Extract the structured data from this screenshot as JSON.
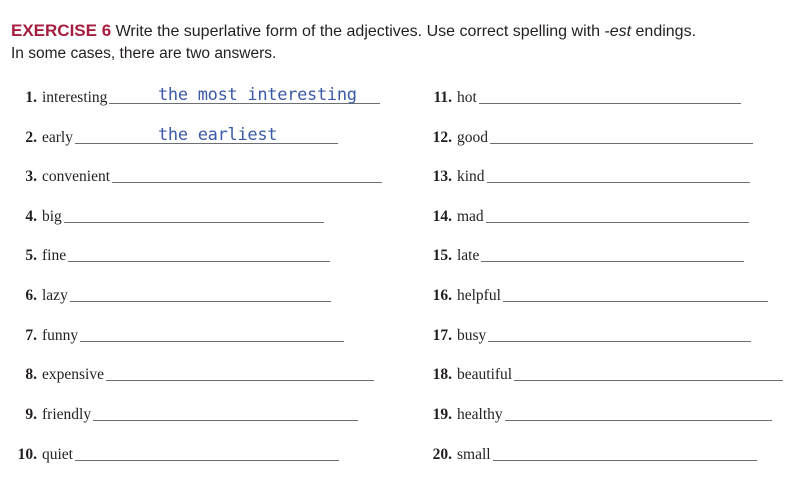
{
  "header": {
    "exercise_label": "EXERCISE 6",
    "instruction_a": "Write the superlative form of the adjectives. Use correct spelling with ",
    "instruction_em": "-est",
    "instruction_b": " endings.",
    "line2": "In some cases, there are two answers."
  },
  "items": [
    {
      "num": "1.",
      "word": "interesting",
      "answer": "the most interesting"
    },
    {
      "num": "2.",
      "word": "early",
      "answer": "the earliest"
    },
    {
      "num": "3.",
      "word": "convenient",
      "answer": ""
    },
    {
      "num": "4.",
      "word": "big",
      "answer": ""
    },
    {
      "num": "5.",
      "word": "fine",
      "answer": ""
    },
    {
      "num": "6.",
      "word": "lazy",
      "answer": ""
    },
    {
      "num": "7.",
      "word": "funny",
      "answer": ""
    },
    {
      "num": "8.",
      "word": "expensive",
      "answer": ""
    },
    {
      "num": "9.",
      "word": "friendly",
      "answer": ""
    },
    {
      "num": "10.",
      "word": "quiet",
      "answer": ""
    },
    {
      "num": "11.",
      "word": "hot",
      "answer": ""
    },
    {
      "num": "12.",
      "word": "good",
      "answer": ""
    },
    {
      "num": "13.",
      "word": "kind",
      "answer": ""
    },
    {
      "num": "14.",
      "word": "mad",
      "answer": ""
    },
    {
      "num": "15.",
      "word": "late",
      "answer": ""
    },
    {
      "num": "16.",
      "word": "helpful",
      "answer": ""
    },
    {
      "num": "17.",
      "word": "busy",
      "answer": ""
    },
    {
      "num": "18.",
      "word": "beautiful",
      "answer": ""
    },
    {
      "num": "19.",
      "word": "healthy",
      "answer": ""
    },
    {
      "num": "20.",
      "word": "small",
      "answer": ""
    }
  ],
  "colors": {
    "exercise_label": "#a51d3f",
    "answer_ink": "#3b5aa6",
    "text": "#231f20"
  }
}
